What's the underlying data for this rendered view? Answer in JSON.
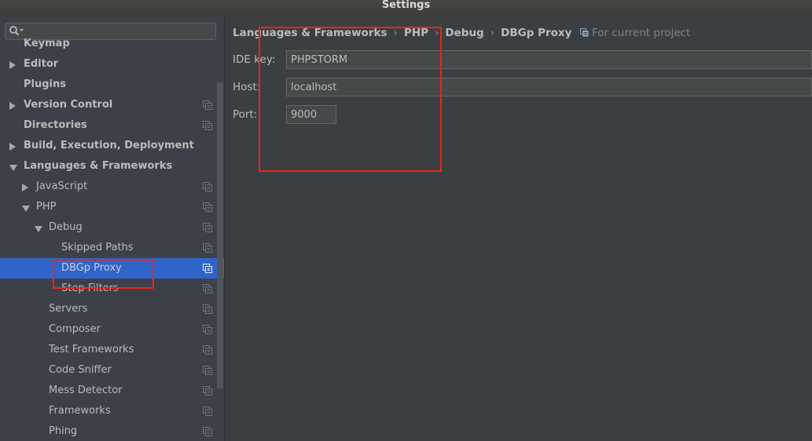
{
  "window": {
    "title": "Settings"
  },
  "search": {
    "placeholder": "",
    "value": ""
  },
  "sidebar": {
    "items": [
      {
        "label": "Keymap",
        "level": 0,
        "bold": true,
        "arrow": "none",
        "scope": false
      },
      {
        "label": "Editor",
        "level": 0,
        "bold": true,
        "arrow": "right",
        "scope": false
      },
      {
        "label": "Plugins",
        "level": 0,
        "bold": true,
        "arrow": "none",
        "scope": false
      },
      {
        "label": "Version Control",
        "level": 0,
        "bold": true,
        "arrow": "right",
        "scope": true
      },
      {
        "label": "Directories",
        "level": 0,
        "bold": true,
        "arrow": "none",
        "scope": true
      },
      {
        "label": "Build, Execution, Deployment",
        "level": 0,
        "bold": true,
        "arrow": "right",
        "scope": false
      },
      {
        "label": "Languages & Frameworks",
        "level": 0,
        "bold": true,
        "arrow": "down",
        "scope": false
      },
      {
        "label": "JavaScript",
        "level": 1,
        "bold": false,
        "arrow": "right",
        "scope": true
      },
      {
        "label": "PHP",
        "level": 1,
        "bold": false,
        "arrow": "down",
        "scope": true
      },
      {
        "label": "Debug",
        "level": 2,
        "bold": false,
        "arrow": "down",
        "scope": true
      },
      {
        "label": "Skipped Paths",
        "level": 3,
        "bold": false,
        "arrow": "none",
        "scope": true
      },
      {
        "label": "DBGp Proxy",
        "level": 3,
        "bold": false,
        "arrow": "none",
        "scope": true,
        "selected": true
      },
      {
        "label": "Step Filters",
        "level": 3,
        "bold": false,
        "arrow": "none",
        "scope": true
      },
      {
        "label": "Servers",
        "level": 2,
        "bold": false,
        "arrow": "none",
        "scope": true
      },
      {
        "label": "Composer",
        "level": 2,
        "bold": false,
        "arrow": "none",
        "scope": true
      },
      {
        "label": "Test Frameworks",
        "level": 2,
        "bold": false,
        "arrow": "none",
        "scope": true
      },
      {
        "label": "Code Sniffer",
        "level": 2,
        "bold": false,
        "arrow": "none",
        "scope": true
      },
      {
        "label": "Mess Detector",
        "level": 2,
        "bold": false,
        "arrow": "none",
        "scope": true
      },
      {
        "label": "Frameworks",
        "level": 2,
        "bold": false,
        "arrow": "none",
        "scope": true
      },
      {
        "label": "Phing",
        "level": 2,
        "bold": false,
        "arrow": "none",
        "scope": true
      }
    ]
  },
  "breadcrumb": {
    "items": [
      "Languages & Frameworks",
      "PHP",
      "Debug",
      "DBGp Proxy"
    ],
    "separator": "›"
  },
  "project_hint": {
    "icon": "project-scope-icon",
    "label": "For current project"
  },
  "form": {
    "ide_key": {
      "label": "IDE key:",
      "value": "PHPSTORM"
    },
    "host": {
      "label": "Host:",
      "value": "localhost"
    },
    "port": {
      "label": "Port:",
      "value": "9000"
    }
  },
  "colors": {
    "selection": "#2f65ca",
    "annotation": "#ee2418",
    "background": "#3c3f41",
    "sidebar": "#3d4048"
  }
}
